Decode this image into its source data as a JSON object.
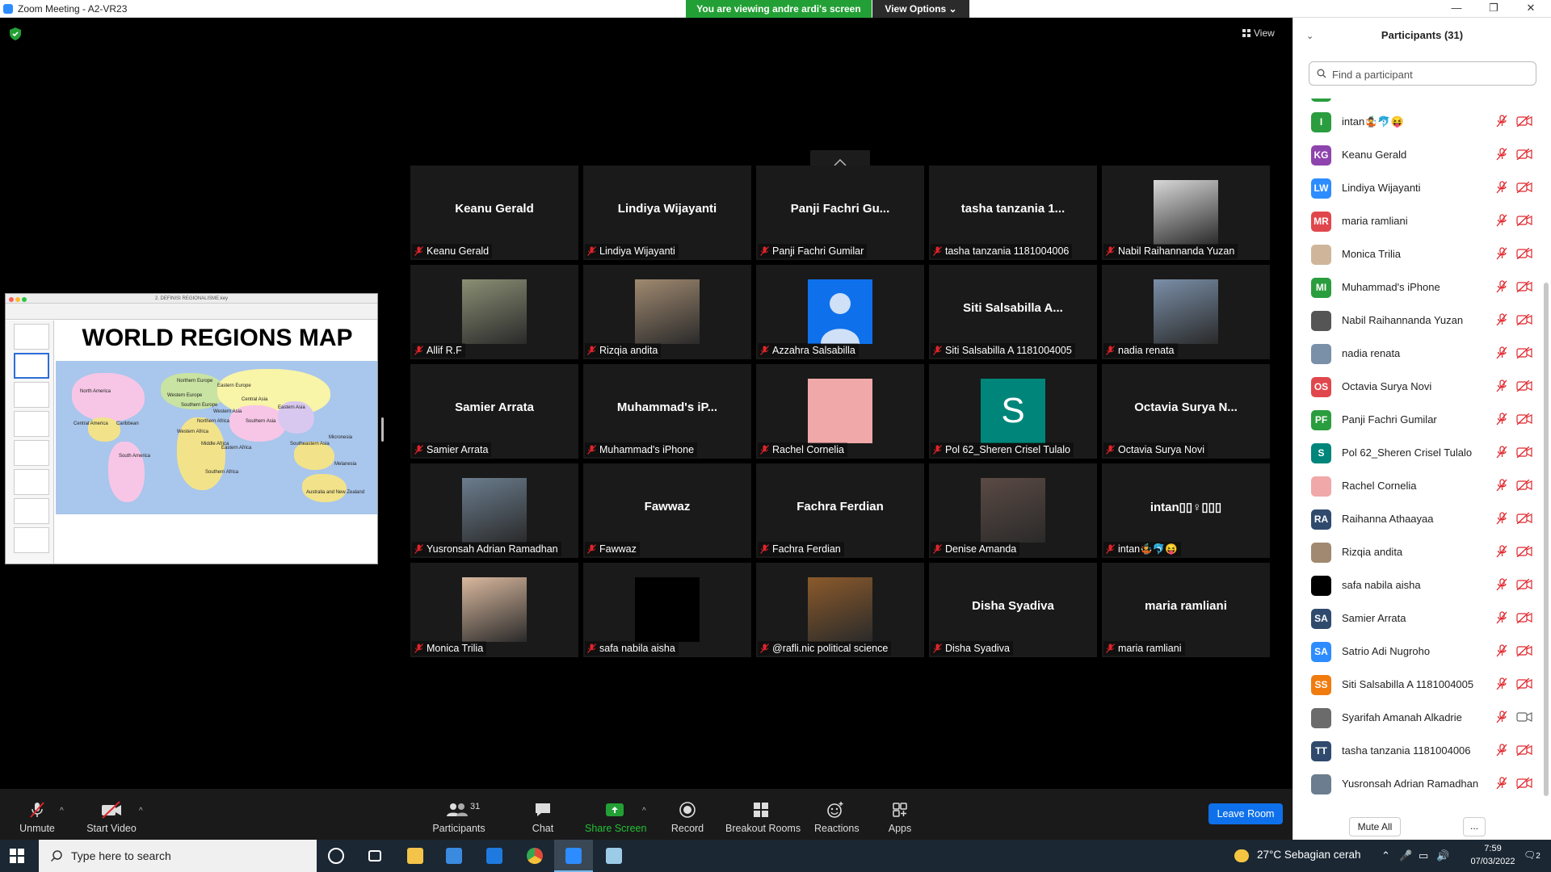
{
  "titlebar": {
    "title": "Zoom Meeting - A2-VR23",
    "minimize": "—",
    "restore": "❐",
    "close": "✕"
  },
  "banner": {
    "viewing": "You are viewing andre ardi's screen",
    "view_options": "View Options ⌄"
  },
  "view_button": "View",
  "shared_screen": {
    "window_title": "2. DEFINISI REGIONALISME.key",
    "slide_title": "WORLD REGIONS MAP",
    "map_labels": [
      "North America",
      "Northern Europe",
      "Western Europe",
      "Eastern Europe",
      "Southern Europe",
      "Central Asia",
      "Western Asia",
      "Eastern Asia",
      "Southern Asia",
      "Northern Africa",
      "Western Africa",
      "Middle Africa",
      "Eastern Africa",
      "Southern Africa",
      "Caribbean",
      "Central America",
      "South America",
      "Southeastern Asia",
      "Micronesia",
      "Melanesia",
      "Australia and New Zealand"
    ]
  },
  "gallery": [
    {
      "big": "Keanu Gerald",
      "caption": "Keanu Gerald",
      "img": "none"
    },
    {
      "big": "Lindiya Wijayanti",
      "caption": "Lindiya Wijayanti",
      "img": "none"
    },
    {
      "big": "Panji Fachri Gu...",
      "caption": "Panji Fachri Gumilar",
      "img": "none"
    },
    {
      "big": "tasha tanzania 1...",
      "caption": "tasha tanzania 1181004006",
      "img": "none"
    },
    {
      "big": "",
      "caption": "Nabil Raihannanda Yuzan",
      "img": "photo",
      "color": "#d8d8d8"
    },
    {
      "big": "",
      "caption": "Allif R.F",
      "img": "photo",
      "color": "#8a8f74"
    },
    {
      "big": "",
      "caption": "Rizqia andita",
      "img": "photo",
      "color": "#a08970"
    },
    {
      "big": "",
      "caption": "Azzahra Salsabilla",
      "img": "person",
      "color": "#0e71eb"
    },
    {
      "big": "Siti Salsabilla A...",
      "caption": "Siti Salsabilla A 1181004005",
      "img": "none"
    },
    {
      "big": "",
      "caption": "nadia renata",
      "img": "photo",
      "color": "#7a8fa8"
    },
    {
      "big": "Samier Arrata",
      "caption": "Samier Arrata",
      "img": "none"
    },
    {
      "big": "Muhammad's iP...",
      "caption": "Muhammad's iPhone",
      "img": "none"
    },
    {
      "big": "",
      "caption": "Rachel Cornelia",
      "img": "solid",
      "color": "#f0a8a8"
    },
    {
      "big": "S",
      "caption": "Pol 62_Sheren Crisel Tulalo",
      "img": "letter",
      "color": "#00857a"
    },
    {
      "big": "Octavia Surya N...",
      "caption": "Octavia Surya Novi",
      "img": "none"
    },
    {
      "big": "",
      "caption": "Yusronsah Adrian Ramadhan",
      "img": "photo",
      "color": "#6b7d8e"
    },
    {
      "big": "Fawwaz",
      "caption": "Fawwaz",
      "img": "none"
    },
    {
      "big": "Fachra Ferdian",
      "caption": "Fachra Ferdian",
      "img": "none"
    },
    {
      "big": "",
      "caption": "Denise Amanda",
      "img": "photo",
      "color": "#5b4a44"
    },
    {
      "big": "intan▯▯♀▯▯▯",
      "caption": "intan🤹🐬😝",
      "img": "none"
    },
    {
      "big": "",
      "caption": "Monica Trilia",
      "img": "photo",
      "color": "#d9b89e"
    },
    {
      "big": "",
      "caption": "safa nabila aisha",
      "img": "solid",
      "color": "#000000"
    },
    {
      "big": "",
      "caption": "@rafli.nic political science",
      "img": "photo",
      "color": "#8b5a2b"
    },
    {
      "big": "Disha Syadiva",
      "caption": "Disha Syadiva",
      "img": "none"
    },
    {
      "big": "maria ramliani",
      "caption": "maria ramliani",
      "img": "none"
    }
  ],
  "toolbar": {
    "unmute": "Unmute",
    "start_video": "Start Video",
    "participants": "Participants",
    "participants_count": "31",
    "chat": "Chat",
    "share_screen": "Share Screen",
    "record": "Record",
    "breakout_rooms": "Breakout Rooms",
    "reactions": "Reactions",
    "apps": "Apps",
    "leave_room": "Leave Room"
  },
  "panel": {
    "title": "Participants (31)",
    "search_placeholder": "Find a participant",
    "mute_all": "Mute All",
    "more": "...",
    "participants": [
      {
        "initials": "I",
        "name": "intan🤹🐬😝",
        "color": "#2a9d3e",
        "video": "off"
      },
      {
        "initials": "KG",
        "name": "Keanu Gerald",
        "color": "#8e44ad",
        "video": "off"
      },
      {
        "initials": "LW",
        "name": "Lindiya Wijayanti",
        "color": "#2d8cff",
        "video": "off"
      },
      {
        "initials": "MR",
        "name": "maria ramliani",
        "color": "#e0474c",
        "video": "off"
      },
      {
        "initials": "",
        "name": "Monica Trilia",
        "color": "#cfb69b",
        "video": "off"
      },
      {
        "initials": "MI",
        "name": "Muhammad's iPhone",
        "color": "#2a9d3e",
        "video": "off"
      },
      {
        "initials": "",
        "name": "Nabil Raihannanda Yuzan",
        "color": "#555555",
        "video": "off"
      },
      {
        "initials": "",
        "name": "nadia renata",
        "color": "#7a8fa8",
        "video": "off"
      },
      {
        "initials": "OS",
        "name": "Octavia Surya Novi",
        "color": "#e0474c",
        "video": "off"
      },
      {
        "initials": "PF",
        "name": "Panji Fachri Gumilar",
        "color": "#2a9d3e",
        "video": "off"
      },
      {
        "initials": "S",
        "name": "Pol 62_Sheren Crisel Tulalo",
        "color": "#00857a",
        "video": "off"
      },
      {
        "initials": "",
        "name": "Rachel Cornelia",
        "color": "#f0a8a8",
        "video": "off"
      },
      {
        "initials": "RA",
        "name": "Raihanna Athaayaa",
        "color": "#2f4a6d",
        "video": "off"
      },
      {
        "initials": "",
        "name": "Rizqia andita",
        "color": "#a08970",
        "video": "off"
      },
      {
        "initials": "",
        "name": "safa nabila aisha",
        "color": "#000000",
        "video": "off"
      },
      {
        "initials": "SA",
        "name": "Samier Arrata",
        "color": "#2f4a6d",
        "video": "off"
      },
      {
        "initials": "SA",
        "name": "Satrio Adi Nugroho",
        "color": "#2d8cff",
        "video": "off"
      },
      {
        "initials": "SS",
        "name": "Siti Salsabilla A 1181004005",
        "color": "#f07c10",
        "video": "off"
      },
      {
        "initials": "",
        "name": "Syarifah Amanah Alkadrie",
        "color": "#6b6b6b",
        "video": "on"
      },
      {
        "initials": "TT",
        "name": "tasha tanzania 1181004006",
        "color": "#2f4a6d",
        "video": "off"
      },
      {
        "initials": "",
        "name": "Yusronsah Adrian Ramadhan",
        "color": "#6b7d8e",
        "video": "off"
      }
    ]
  },
  "taskbar": {
    "search_placeholder": "Type here to search",
    "weather": "27°C  Sebagian cerah",
    "time": "7:59",
    "date": "07/03/2022",
    "notifications": "2"
  },
  "colors": {
    "zoom_blue": "#0e71eb",
    "banner_green": "#23a035",
    "muted_red": "#e0242a"
  }
}
